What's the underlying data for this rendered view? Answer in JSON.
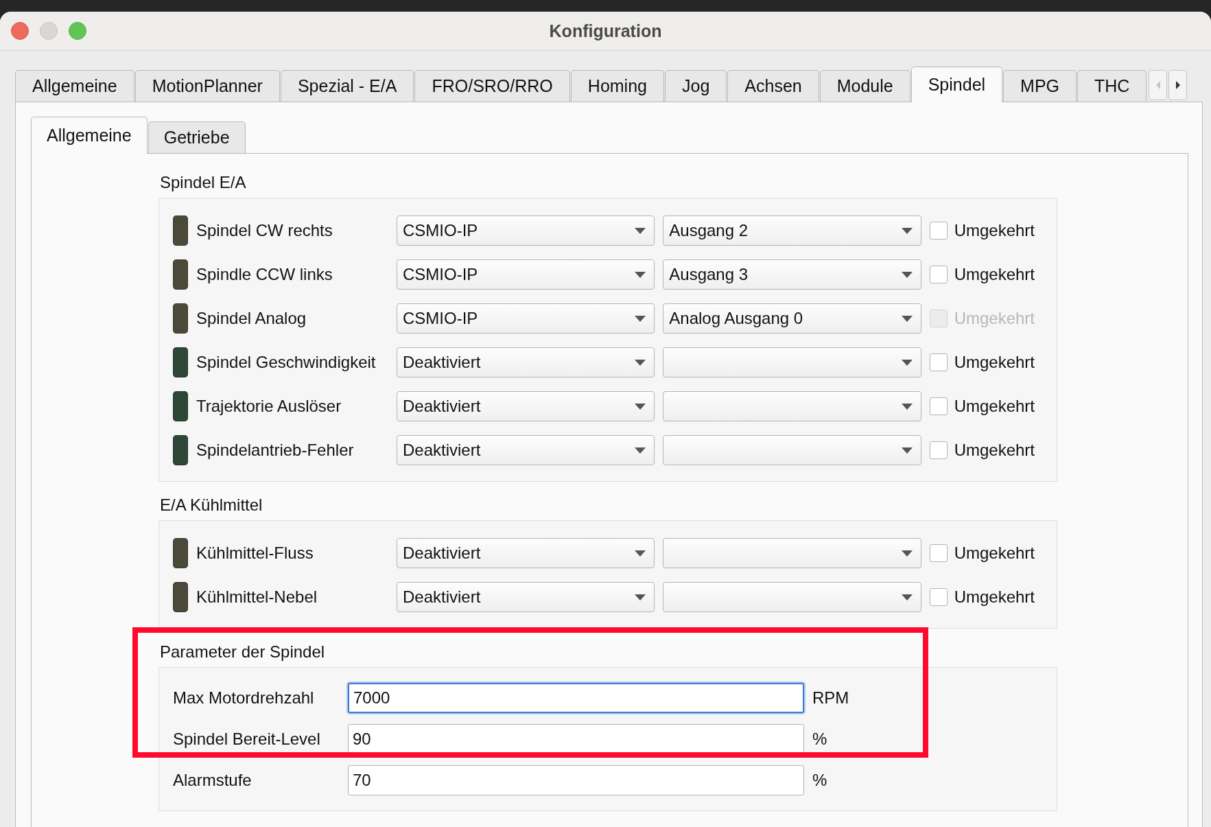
{
  "window": {
    "title": "Konfiguration"
  },
  "tabs": [
    {
      "label": "Allgemeine",
      "selected": false
    },
    {
      "label": "MotionPlanner",
      "selected": false
    },
    {
      "label": "Spezial - E/A",
      "selected": false
    },
    {
      "label": "FRO/SRO/RRO",
      "selected": false
    },
    {
      "label": "Homing",
      "selected": false
    },
    {
      "label": "Jog",
      "selected": false
    },
    {
      "label": "Achsen",
      "selected": false
    },
    {
      "label": "Module",
      "selected": false
    },
    {
      "label": "Spindel",
      "selected": true
    },
    {
      "label": "MPG",
      "selected": false
    },
    {
      "label": "THC",
      "selected": false
    }
  ],
  "tab_scroll": {
    "left_disabled": true,
    "right_disabled": false
  },
  "subtabs": [
    {
      "label": "Allgemeine",
      "selected": true
    },
    {
      "label": "Getriebe",
      "selected": false
    }
  ],
  "io_groups": [
    {
      "title": "Spindel E/A",
      "rows": [
        {
          "label": "Spindel CW rechts",
          "color": "#4b4a3a",
          "device": "CSMIO-IP",
          "port": "Ausgang 2",
          "invert_label": "Umgekehrt",
          "checked": false,
          "disabled": false
        },
        {
          "label": "Spindle CCW links",
          "color": "#4b4a3a",
          "device": "CSMIO-IP",
          "port": "Ausgang 3",
          "invert_label": "Umgekehrt",
          "checked": false,
          "disabled": false
        },
        {
          "label": "Spindel Analog",
          "color": "#4b4a3a",
          "device": "CSMIO-IP",
          "port": "Analog Ausgang 0",
          "invert_label": "Umgekehrt",
          "checked": false,
          "disabled": true
        },
        {
          "label": "Spindel Geschwindigkeit",
          "color": "#2e4737",
          "device": "Deaktiviert",
          "invert_label": "Umgekehrt",
          "checked": false,
          "disabled": false
        },
        {
          "label": "Trajektorie Auslöser",
          "color": "#2e4737",
          "device": "Deaktiviert",
          "invert_label": "Umgekehrt",
          "checked": false,
          "disabled": false
        },
        {
          "label": "Spindelantrieb-Fehler",
          "color": "#2e4737",
          "device": "Deaktiviert",
          "invert_label": "Umgekehrt",
          "checked": false,
          "disabled": false
        }
      ]
    },
    {
      "title": "E/A Kühlmittel",
      "rows": [
        {
          "label": "Kühlmittel-Fluss",
          "color": "#4b4a3a",
          "device": "Deaktiviert",
          "invert_label": "Umgekehrt",
          "checked": false,
          "disabled": false
        },
        {
          "label": "Kühlmittel-Nebel",
          "color": "#4b4a3a",
          "device": "Deaktiviert",
          "invert_label": "Umgekehrt",
          "checked": false,
          "disabled": false
        }
      ]
    }
  ],
  "parameters": {
    "title": "Parameter der Spindel",
    "highlighted": true,
    "fields": [
      {
        "label": "Max Motordrehzahl",
        "value": "7000",
        "unit": "RPM",
        "focused": true
      },
      {
        "label": "Spindel Bereit-Level",
        "value": "90",
        "unit": "%",
        "focused": false
      },
      {
        "label": "Alarmstufe",
        "value": "70",
        "unit": "%",
        "focused": false
      }
    ]
  }
}
